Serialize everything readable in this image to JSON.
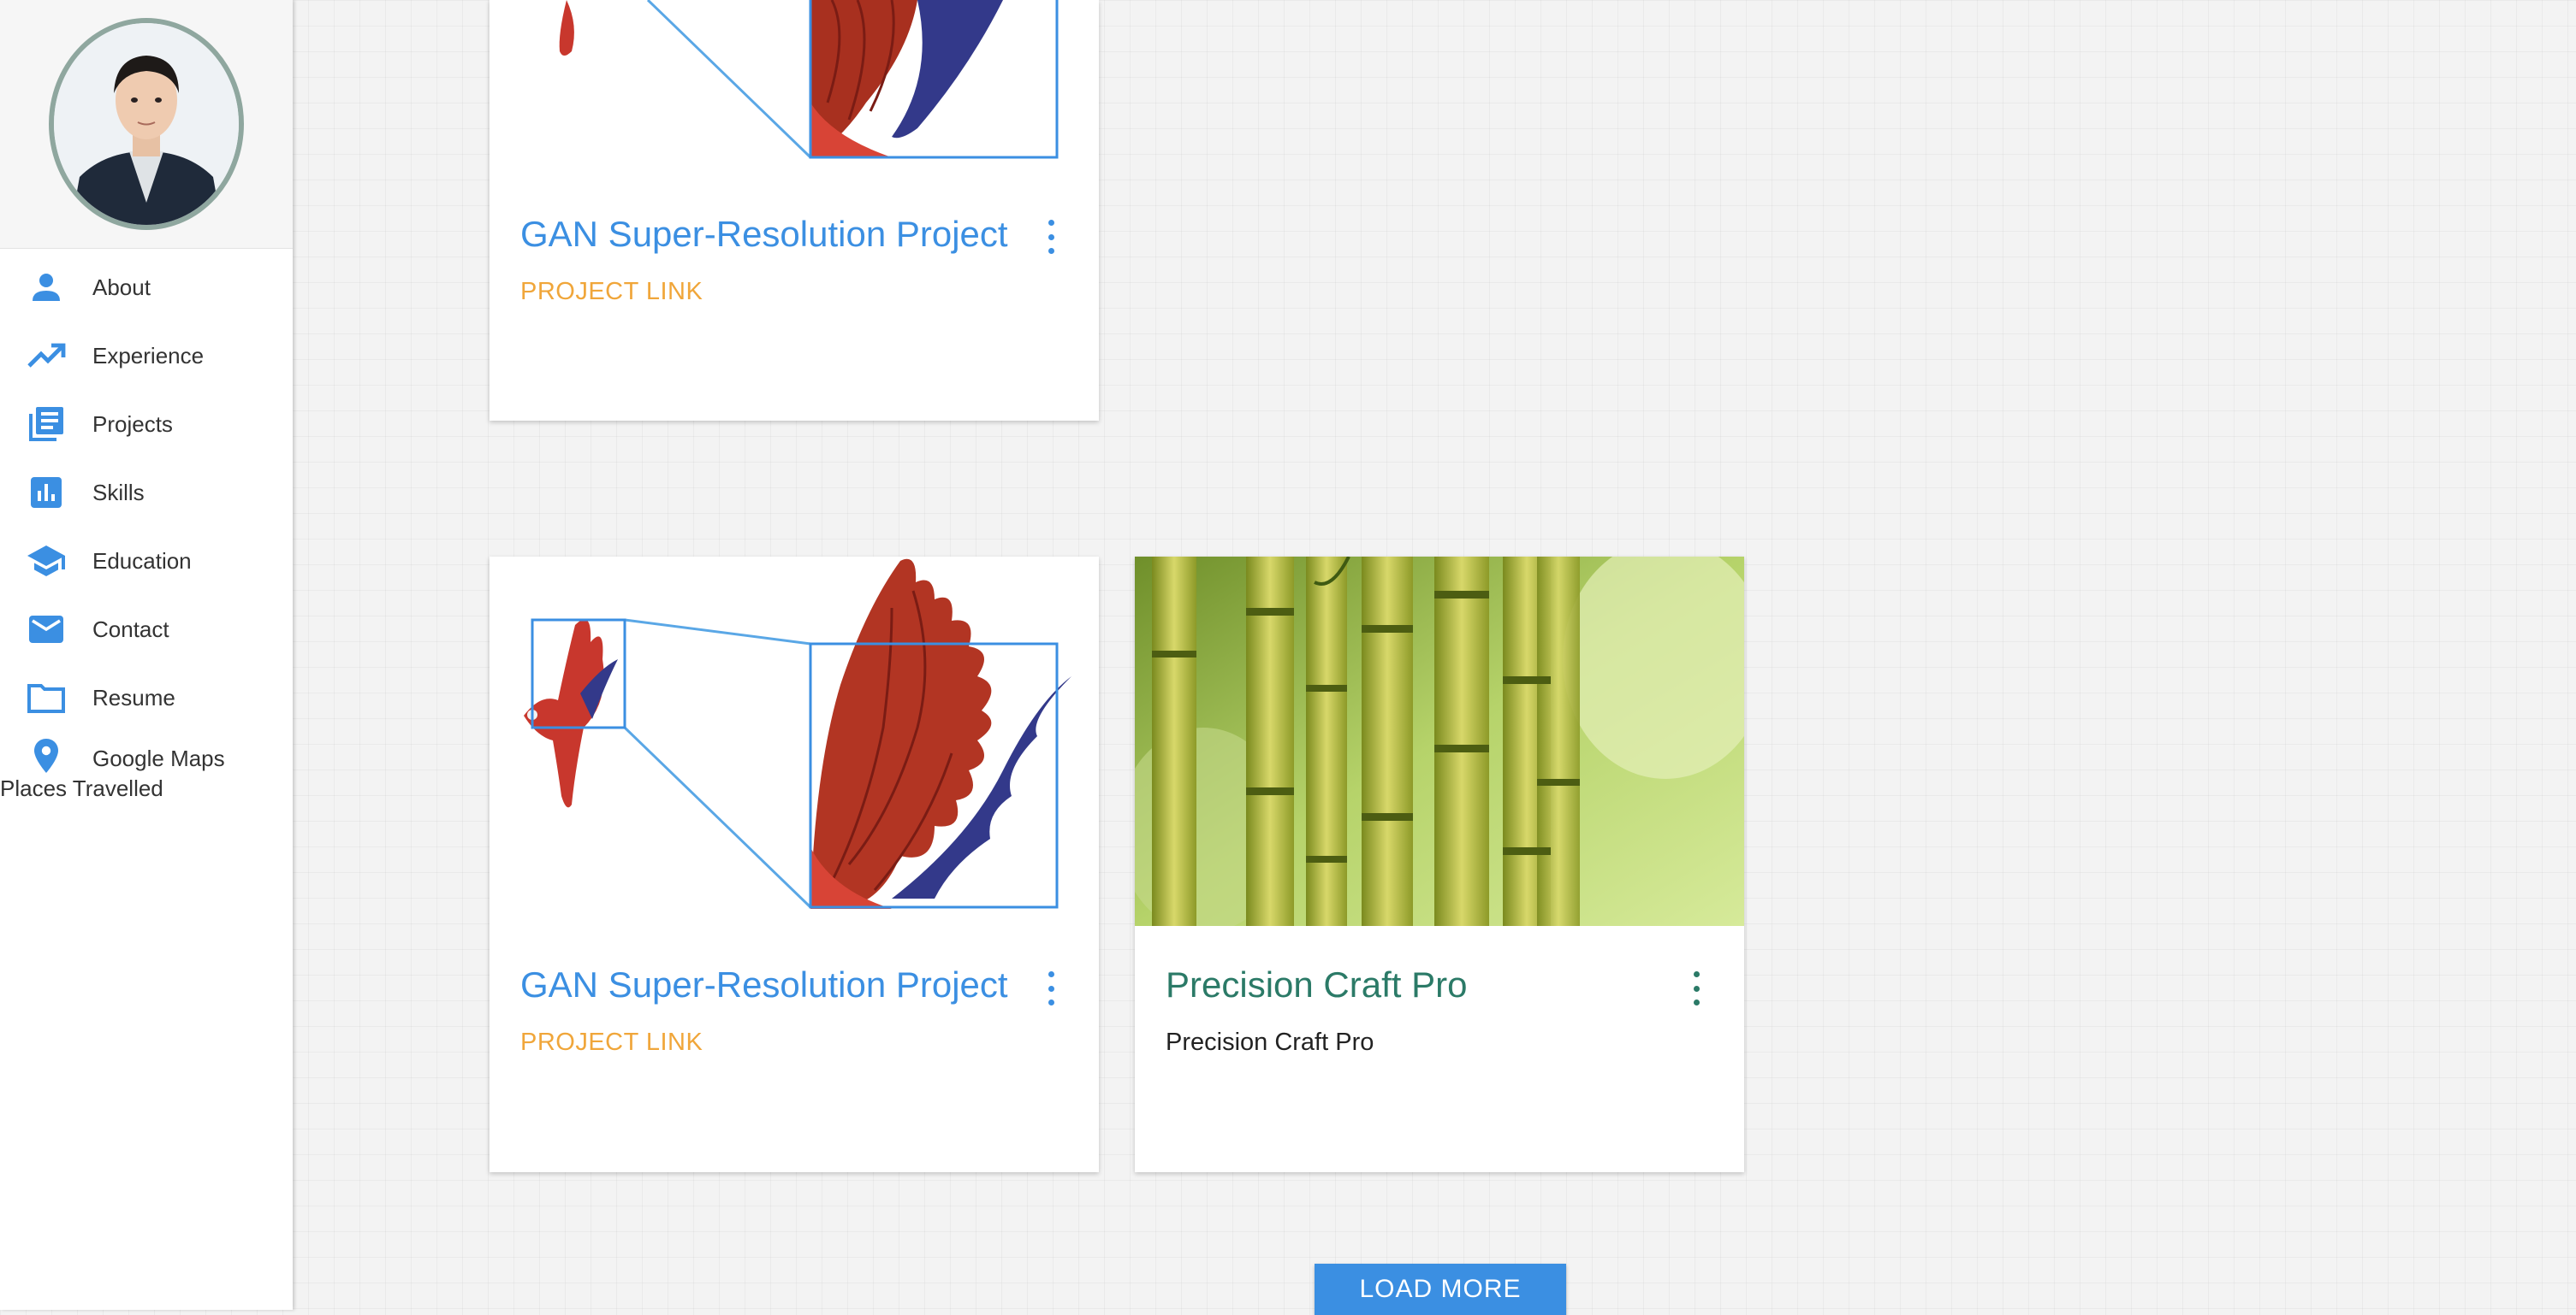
{
  "sidebar": {
    "items": [
      {
        "label": "About",
        "icon": "person-icon"
      },
      {
        "label": "Experience",
        "icon": "trending-up-icon"
      },
      {
        "label": "Projects",
        "icon": "projects-icon"
      },
      {
        "label": "Skills",
        "icon": "bar-chart-icon"
      },
      {
        "label": "Education",
        "icon": "graduation-cap-icon"
      },
      {
        "label": "Contact",
        "icon": "mail-icon"
      },
      {
        "label": "Resume",
        "icon": "folder-icon"
      },
      {
        "label": "Google Maps",
        "sublabel": "Places Travelled",
        "icon": "map-pin-icon"
      }
    ]
  },
  "cards": [
    {
      "title": "GAN Super-Resolution Project",
      "link": "PROJECT LINK"
    },
    {
      "title": "GAN Super-Resolution Project",
      "link": "PROJECT LINK"
    },
    {
      "title": "Precision Craft Pro",
      "description": "Precision Craft Pro"
    }
  ],
  "load_more": {
    "label": "LOAD MORE"
  },
  "colors": {
    "accent": "#3b8fe2",
    "link": "#f0a63a",
    "teal": "#2b7a67"
  }
}
